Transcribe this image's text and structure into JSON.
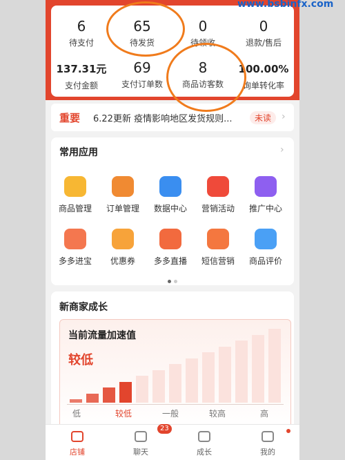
{
  "watermark": "www.bsbinfx.com",
  "stats": [
    {
      "value": "6",
      "label": "待支付"
    },
    {
      "value": "65",
      "label": "待发货"
    },
    {
      "value": "0",
      "label": "待领收"
    },
    {
      "value": "0",
      "label": "退款/售后"
    },
    {
      "value": "137.31元",
      "label": "支付金额"
    },
    {
      "value": "69",
      "label": "支付订单数"
    },
    {
      "value": "8",
      "label": "商品访客数"
    },
    {
      "value": "100.00%",
      "label": "询单转化率"
    }
  ],
  "notice": {
    "tag": "重要",
    "text": "6.22更新 疫情影响地区发货规则...",
    "status": "未读"
  },
  "apps": {
    "title": "常用应用",
    "items": [
      {
        "label": "商品管理",
        "icon": "product-manage-icon",
        "color": "#f7b733"
      },
      {
        "label": "订单管理",
        "icon": "order-manage-icon",
        "color": "#f08a32"
      },
      {
        "label": "数据中心",
        "icon": "data-center-icon",
        "color": "#3a8ef0"
      },
      {
        "label": "营销活动",
        "icon": "flame-icon",
        "color": "#ef4a3a"
      },
      {
        "label": "推广中心",
        "icon": "rocket-icon",
        "color": "#8e5ff0"
      },
      {
        "label": "多多进宝",
        "icon": "treasure-icon",
        "color": "#f4774f"
      },
      {
        "label": "优惠券",
        "icon": "coupon-icon",
        "color": "#f7a33a"
      },
      {
        "label": "多多直播",
        "icon": "live-icon",
        "color": "#f26a3e"
      },
      {
        "label": "短信营销",
        "icon": "sms-icon",
        "color": "#f4773f"
      },
      {
        "label": "商品评价",
        "icon": "review-icon",
        "color": "#4aa0f5"
      }
    ]
  },
  "growth": {
    "title": "新商家成长",
    "panel_title": "当前流量加速值",
    "level": "较低",
    "current_level": "较低",
    "accent": "#e2452d"
  },
  "chart_data": {
    "type": "bar",
    "title": "当前流量加速值",
    "categories": [
      "低",
      "较低",
      "一般",
      "较高",
      "高"
    ],
    "current": "较低",
    "ticks": [
      "低",
      "较低",
      "一般",
      "较高",
      "高"
    ]
  },
  "tabs": [
    {
      "label": "店铺",
      "icon": "store-icon",
      "active": true
    },
    {
      "label": "聊天",
      "icon": "chat-icon",
      "badge": "23"
    },
    {
      "label": "成长",
      "icon": "growth-book-icon"
    },
    {
      "label": "我的",
      "icon": "profile-icon",
      "dot": true
    }
  ]
}
